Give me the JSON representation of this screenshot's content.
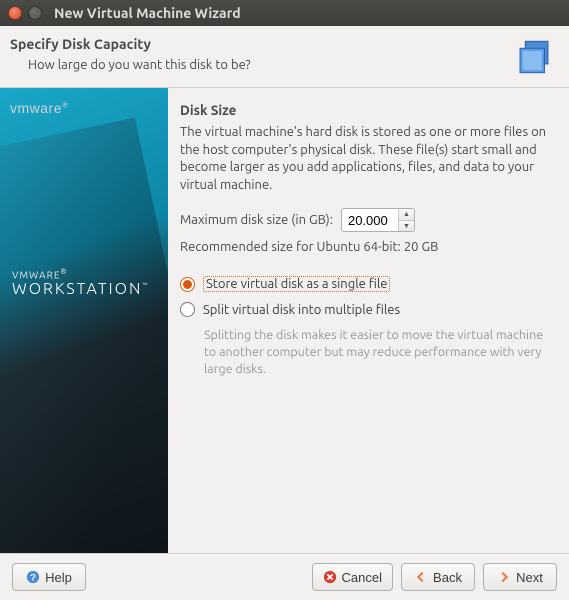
{
  "window": {
    "title": "New Virtual Machine Wizard"
  },
  "header": {
    "title": "Specify Disk Capacity",
    "subtitle": "How large do you want this disk to be?"
  },
  "sidebar": {
    "logo_small": "vmware",
    "brand_top": "VMWARE",
    "brand_main": "WORKSTATION"
  },
  "content": {
    "section_title": "Disk Size",
    "description": "The virtual machine's hard disk is stored as one or more files on the host computer's physical disk. These file(s) start small and become larger as you add applications, files, and data to your virtual machine.",
    "max_size_label": "Maximum disk size (in GB):",
    "max_size_value": "20.000",
    "recommended": "Recommended size for Ubuntu 64-bit: 20 GB",
    "radio_single": "Store virtual disk as a single file",
    "radio_split": "Split virtual disk into multiple files",
    "split_hint": "Splitting the disk makes it easier to move the virtual machine to another computer but may reduce performance with very large disks.",
    "selected_option": "single"
  },
  "footer": {
    "help": "Help",
    "cancel": "Cancel",
    "back": "Back",
    "next": "Next"
  },
  "colors": {
    "accent_orange": "#e97f3b",
    "close_red": "#d84b28"
  }
}
